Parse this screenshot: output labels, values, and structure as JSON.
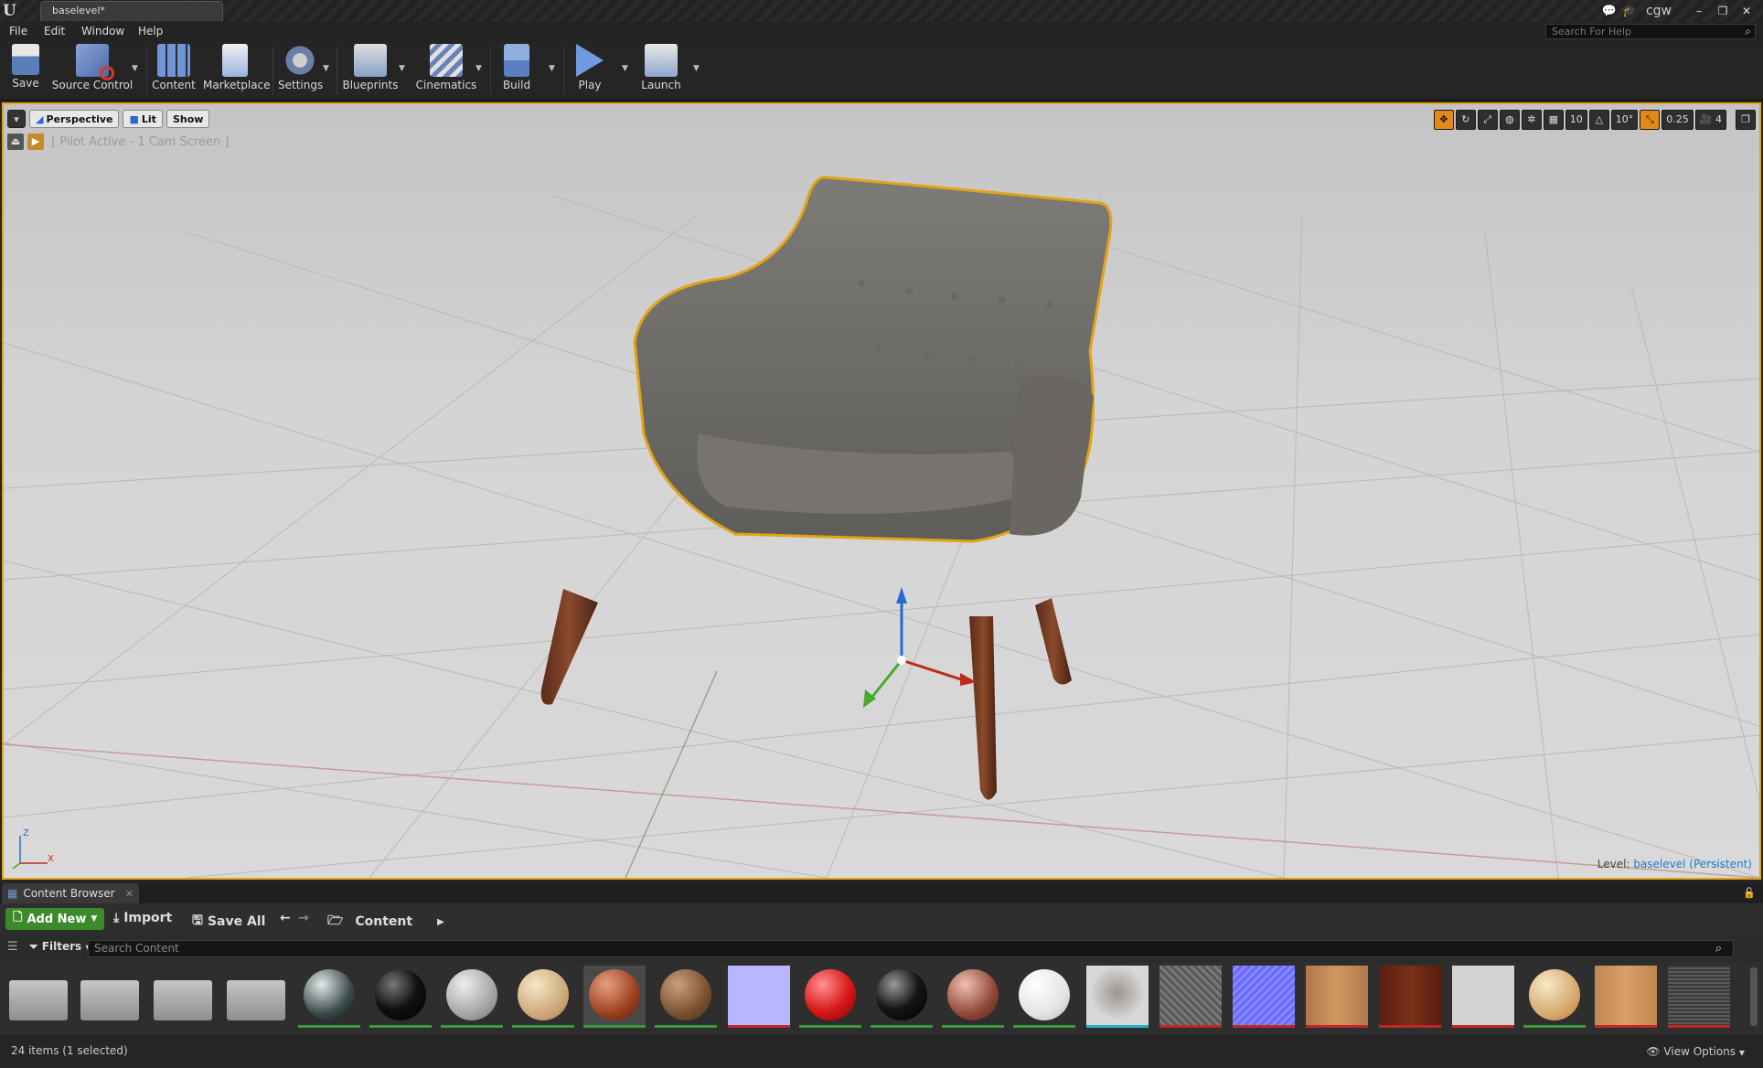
{
  "window": {
    "tab_title": "baselevel*",
    "user": "cgw",
    "logo_letter": "U",
    "minimize": "–",
    "restore": "❐",
    "close": "✕"
  },
  "menu": [
    "File",
    "Edit",
    "Window",
    "Help"
  ],
  "help_search": {
    "placeholder": "Search For Help"
  },
  "toolbar": {
    "save": "Save",
    "source_control": "Source Control",
    "content": "Content",
    "marketplace": "Marketplace",
    "settings": "Settings",
    "blueprints": "Blueprints",
    "cinematics": "Cinematics",
    "build": "Build",
    "play": "Play",
    "launch": "Launch"
  },
  "viewport": {
    "perspective": "Perspective",
    "lit": "Lit",
    "show": "Show",
    "pilot_text": "[ Pilot Active - 1 Cam Screen ]",
    "grid_snap": "10",
    "rotate_snap": "10°",
    "scale_snap": "0.25",
    "camera_speed": "4",
    "level_prefix": "Level:",
    "level_name": "baselevel (Persistent)",
    "axis_z": "Z",
    "axis_x": "X"
  },
  "content_browser": {
    "tab_label": "Content Browser",
    "add_new": "Add New",
    "import": "Import",
    "save_all": "Save All",
    "path": "Content",
    "filters": "Filters",
    "search_placeholder": "Search Content",
    "item_count": "24 items (1 selected)",
    "view_options": "View Options"
  },
  "colors": {
    "selection": "#e3a316",
    "add_new_green": "#3d8a2c",
    "level_link": "#1b7dc9"
  }
}
